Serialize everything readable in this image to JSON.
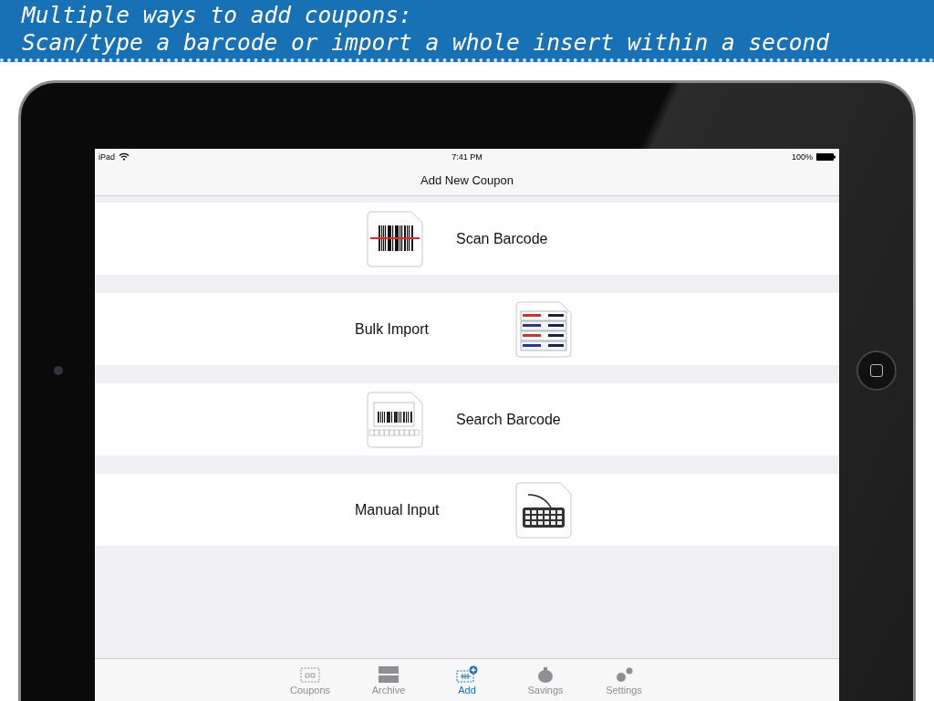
{
  "banner": {
    "lines": [
      "Multiple ways to add coupons:",
      "Scan/type a barcode or import a whole insert within a second"
    ]
  },
  "status_bar": {
    "device": "iPad",
    "time": "7:41 PM",
    "battery": "100%"
  },
  "nav": {
    "title": "Add New Coupon"
  },
  "options": [
    {
      "label": "Scan Barcode",
      "kind": "scan"
    },
    {
      "label": "Bulk Import",
      "kind": "bulk"
    },
    {
      "label": "Search Barcode",
      "kind": "search"
    },
    {
      "label": "Manual Input",
      "kind": "keyboard"
    }
  ],
  "tabs": [
    {
      "label": "Coupons",
      "kind": "coupons",
      "selected": false
    },
    {
      "label": "Archive",
      "kind": "archive",
      "selected": false
    },
    {
      "label": "Add",
      "kind": "add",
      "selected": true
    },
    {
      "label": "Savings",
      "kind": "savings",
      "selected": false
    },
    {
      "label": "Settings",
      "kind": "settings",
      "selected": false
    }
  ]
}
